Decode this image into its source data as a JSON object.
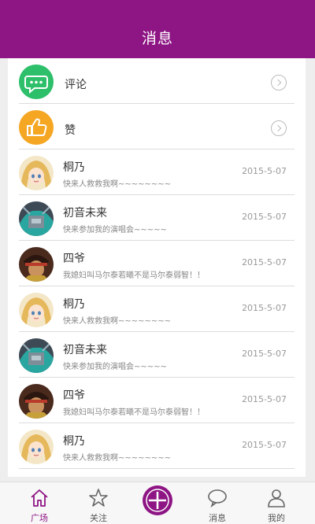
{
  "header": {
    "title": "消息"
  },
  "actions": [
    {
      "label": "评论",
      "icon": "comment-bubble-icon",
      "color": "#2dbf6a"
    },
    {
      "label": "赞",
      "icon": "thumbs-up-icon",
      "color": "#f5a623"
    }
  ],
  "messages": [
    {
      "name": "桐乃",
      "text": "快来人救救我啊~~~~~~~~",
      "date": "2015-5-07",
      "avatar": "avatar-kirino"
    },
    {
      "name": "初音未来",
      "text": "快来参加我的演唱会~~~~~",
      "date": "2015-5-07",
      "avatar": "avatar-miku"
    },
    {
      "name": "四爷",
      "text": "我媳妇叫马尔泰若曦不是马尔泰弱智！！",
      "date": "2015-5-07",
      "avatar": "avatar-siye"
    },
    {
      "name": "桐乃",
      "text": "快来人救救我啊~~~~~~~~",
      "date": "2015-5-07",
      "avatar": "avatar-kirino"
    },
    {
      "name": "初音未来",
      "text": "快来参加我的演唱会~~~~~",
      "date": "2015-5-07",
      "avatar": "avatar-miku"
    },
    {
      "name": "四爷",
      "text": "我媳妇叫马尔泰若曦不是马尔泰弱智！！",
      "date": "2015-5-07",
      "avatar": "avatar-siye"
    },
    {
      "name": "桐乃",
      "text": "快来人救救我啊~~~~~~~~",
      "date": "2015-5-07",
      "avatar": "avatar-kirino"
    }
  ],
  "tabs": [
    {
      "label": "广场",
      "icon": "home-icon",
      "active": true
    },
    {
      "label": "关注",
      "icon": "star-icon",
      "active": false
    },
    {
      "label": "",
      "icon": "plus-icon",
      "active": false
    },
    {
      "label": "消息",
      "icon": "message-bubble-icon",
      "active": false
    },
    {
      "label": "我的",
      "icon": "person-icon",
      "active": false
    }
  ],
  "colors": {
    "brand": "#8e1584",
    "background": "#eeeeee"
  }
}
